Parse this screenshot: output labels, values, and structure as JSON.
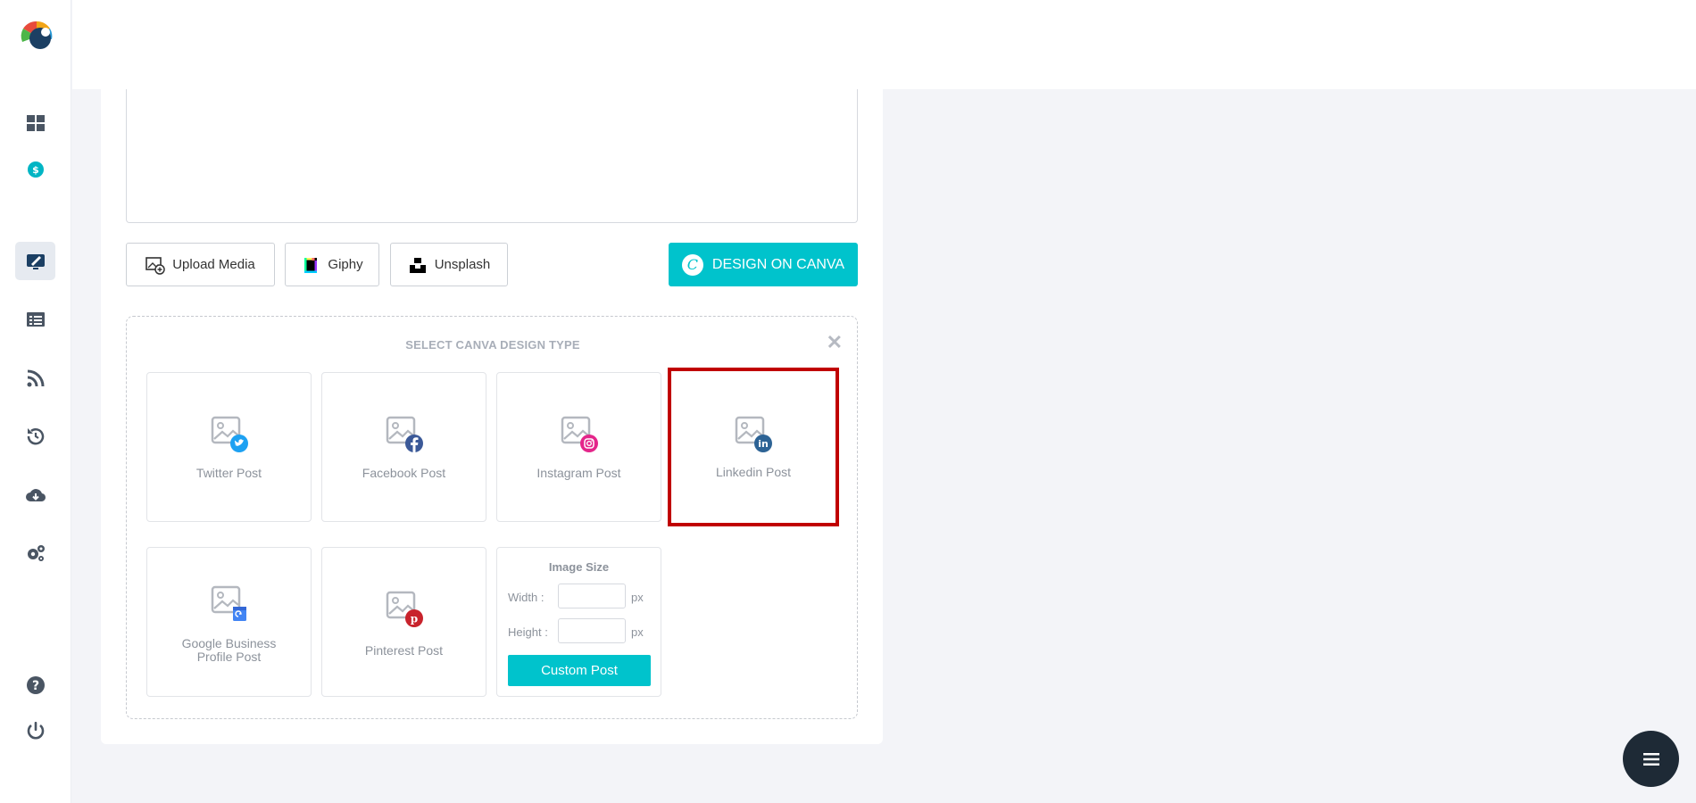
{
  "toolbar": {
    "upload_media": "Upload Media",
    "giphy": "Giphy",
    "unsplash": "Unsplash",
    "design_on_canva": "DESIGN ON CANVA",
    "canva_letter": "C"
  },
  "design_panel": {
    "title": "SELECT CANVA DESIGN TYPE",
    "close": "✕",
    "tiles": [
      {
        "label": "Twitter Post",
        "icon": "twitter-post-icon",
        "badge_color": "#1da1f2"
      },
      {
        "label": "Facebook Post",
        "icon": "facebook-post-icon",
        "badge_color": "#3b5998"
      },
      {
        "label": "Instagram Post",
        "icon": "instagram-post-icon",
        "badge_color": "#e4258a"
      },
      {
        "label": "Linkedin Post",
        "icon": "linkedin-post-icon",
        "badge_color": "#2d6395",
        "selected": true
      },
      {
        "label": "Google Business Profile Post",
        "label_line1": "Google Business",
        "label_line2": "Profile Post",
        "icon": "google-business-post-icon",
        "badge_color": "#4285f4"
      },
      {
        "label": "Pinterest Post",
        "icon": "pinterest-post-icon",
        "badge_color": "#c8232c"
      }
    ],
    "custom_size": {
      "title": "Image Size",
      "width_label": "Width :",
      "height_label": "Height :",
      "unit": "px",
      "width_value": "",
      "height_value": "",
      "button": "Custom Post"
    }
  },
  "colors": {
    "accent": "#00c3cc",
    "selected_outline": "#c00000",
    "fab": "#1e2a36"
  },
  "sidebar_icons": [
    "dashboard-icon",
    "billing-icon",
    "compose-icon",
    "posts-list-icon",
    "rss-feed-icon",
    "history-icon",
    "download-icon",
    "settings-icon",
    "help-icon",
    "power-icon"
  ]
}
